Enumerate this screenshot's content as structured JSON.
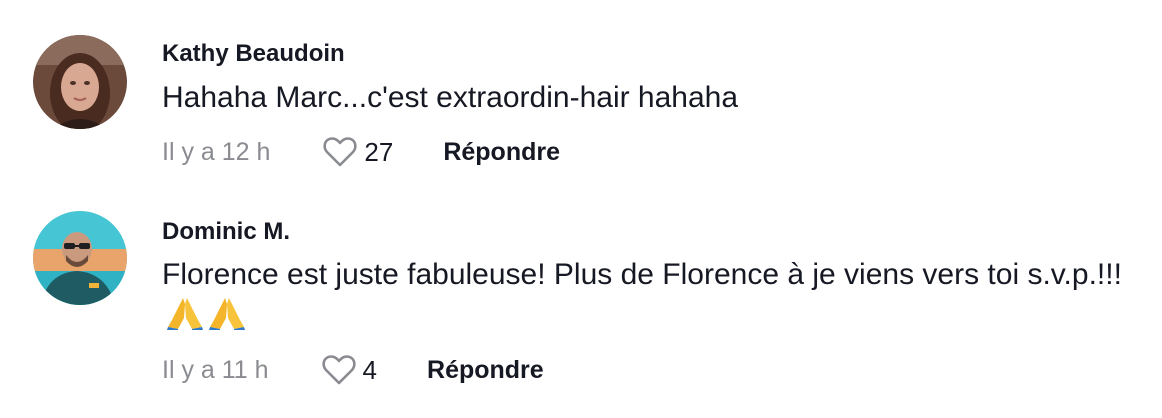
{
  "comments": [
    {
      "author": "Kathy Beaudoin",
      "text": "Hahaha Marc...c'est extraordin-hair hahaha",
      "time": "Il y a 12 h",
      "likes": "27",
      "reply_label": "Répondre",
      "icons": [
        "avatar",
        "heart-outline-icon"
      ]
    },
    {
      "author": "Dominic M.",
      "text": "Florence est juste fabuleuse! Plus de Florence à je viens vers toi s.v.p.!!!",
      "emoji": "🙏🙏",
      "time": "Il y a 11 h",
      "likes": "4",
      "reply_label": "Répondre",
      "icons": [
        "avatar",
        "heart-outline-icon",
        "folded-hands-emoji"
      ]
    }
  ],
  "colors": {
    "text_primary": "#161823",
    "text_secondary": "#8a8b91",
    "background": "#ffffff"
  }
}
